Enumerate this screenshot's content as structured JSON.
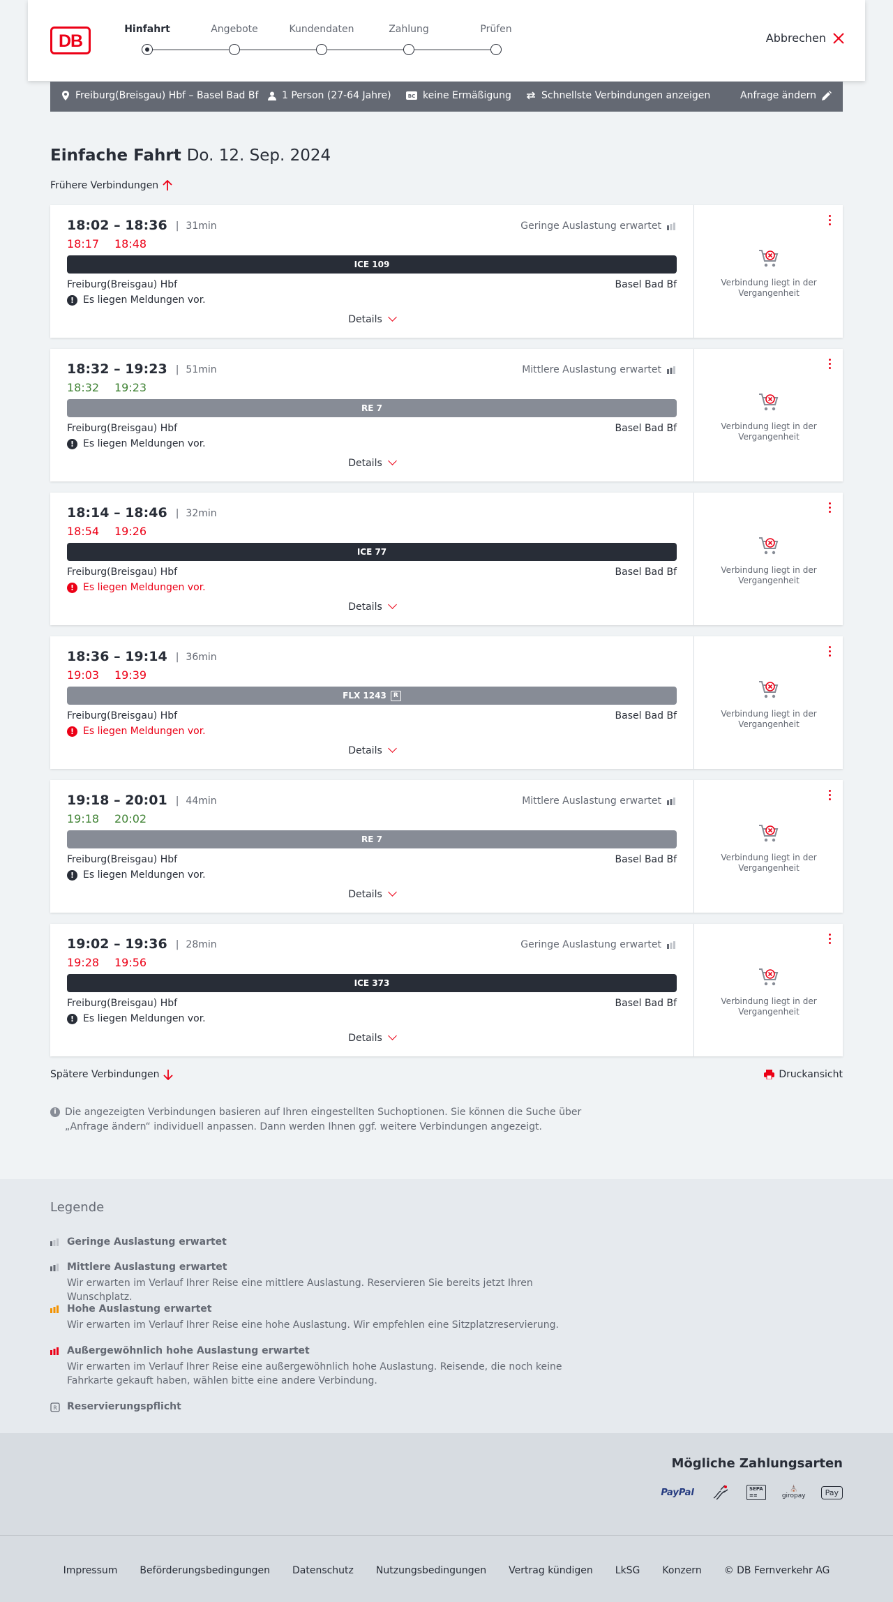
{
  "header": {
    "logo_text": "DB",
    "steps": [
      "Hinfahrt",
      "Angebote",
      "Kundendaten",
      "Zahlung",
      "Prüfen"
    ],
    "active_step": "Hinfahrt",
    "cancel_label": "Abbrechen"
  },
  "filter": {
    "route": "Freiburg(Breisgau) Hbf – Basel Bad Bf",
    "passengers": "1 Person (27-64 Jahre)",
    "discount": "keine Ermäßigung",
    "fastest": "Schnellste Verbindungen anzeigen",
    "change_label": "Anfrage ändern"
  },
  "page": {
    "title": "Einfache Fahrt",
    "date": "Do. 12. Sep. 2024",
    "earlier_label": "Frühere Verbindungen",
    "later_label": "Spätere Verbindungen",
    "print_label": "Druckansicht",
    "info_text": "Die angezeigten Verbindungen basieren auf Ihren eingestellten Suchoptionen. Sie können die Suche über „Anfrage ändern“ individuell anpassen. Dann werden Ihnen ggf. weitere Verbindungen angezeigt."
  },
  "connections": [
    {
      "times": "18:02 – 18:36",
      "duration": "31min",
      "rt_dep": "18:17",
      "rt_arr": "18:48",
      "rt_status": "red",
      "occupancy": "Geringe Auslastung erwartet",
      "train": "ICE 109",
      "train_style": "dark",
      "reservation": false,
      "from": "Freiburg(Breisgau) Hbf",
      "to": "Basel Bad Bf",
      "message": "Es liegen Meldungen vor.",
      "message_style": "normal",
      "details": "Details",
      "past_text": "Verbindung liegt in der Vergangenheit"
    },
    {
      "times": "18:32 – 19:23",
      "duration": "51min",
      "rt_dep": "18:32",
      "rt_arr": "19:23",
      "rt_status": "green",
      "occupancy": "Mittlere Auslastung erwartet",
      "train": "RE 7",
      "train_style": "grey",
      "reservation": false,
      "from": "Freiburg(Breisgau) Hbf",
      "to": "Basel Bad Bf",
      "message": "Es liegen Meldungen vor.",
      "message_style": "normal",
      "details": "Details",
      "past_text": "Verbindung liegt in der Vergangenheit"
    },
    {
      "times": "18:14 – 18:46",
      "duration": "32min",
      "rt_dep": "18:54",
      "rt_arr": "19:26",
      "rt_status": "red",
      "occupancy": "",
      "train": "ICE 77",
      "train_style": "dark",
      "reservation": false,
      "from": "Freiburg(Breisgau) Hbf",
      "to": "Basel Bad Bf",
      "message": "Es liegen Meldungen vor.",
      "message_style": "red",
      "details": "Details",
      "past_text": "Verbindung liegt in der Vergangenheit"
    },
    {
      "times": "18:36 – 19:14",
      "duration": "36min",
      "rt_dep": "19:03",
      "rt_arr": "19:39",
      "rt_status": "red",
      "occupancy": "",
      "train": "FLX 1243",
      "train_style": "grey",
      "reservation": true,
      "reservation_symbol": "R",
      "from": "Freiburg(Breisgau) Hbf",
      "to": "Basel Bad Bf",
      "message": "Es liegen Meldungen vor.",
      "message_style": "red",
      "details": "Details",
      "past_text": "Verbindung liegt in der Vergangenheit"
    },
    {
      "times": "19:18 – 20:01",
      "duration": "44min",
      "rt_dep": "19:18",
      "rt_arr": "20:02",
      "rt_status": "green",
      "occupancy": "Mittlere Auslastung erwartet",
      "train": "RE 7",
      "train_style": "grey",
      "reservation": false,
      "from": "Freiburg(Breisgau) Hbf",
      "to": "Basel Bad Bf",
      "message": "Es liegen Meldungen vor.",
      "message_style": "normal",
      "details": "Details",
      "past_text": "Verbindung liegt in der Vergangenheit"
    },
    {
      "times": "19:02 – 19:36",
      "duration": "28min",
      "rt_dep": "19:28",
      "rt_arr": "19:56",
      "rt_status": "red",
      "occupancy": "Geringe Auslastung erwartet",
      "train": "ICE 373",
      "train_style": "dark",
      "reservation": false,
      "from": "Freiburg(Breisgau) Hbf",
      "to": "Basel Bad Bf",
      "message": "Es liegen Meldungen vor.",
      "message_style": "normal",
      "details": "Details",
      "past_text": "Verbindung liegt in der Vergangenheit"
    }
  ],
  "legend": {
    "title": "Legende",
    "items": [
      {
        "title": "Geringe Auslastung erwartet",
        "text": "",
        "color": "#646973",
        "level": 1
      },
      {
        "title": "Mittlere Auslastung erwartet",
        "text": "Wir erwarten im Verlauf Ihrer Reise eine mittlere Auslastung. Reservieren Sie bereits jetzt Ihren Wunschplatz.",
        "color": "#646973",
        "level": 2
      },
      {
        "title": "Hohe Auslastung erwartet",
        "text": "Wir erwarten im Verlauf Ihrer Reise eine hohe Auslastung. Wir empfehlen eine Sitzplatzreservierung.",
        "color": "#f39200",
        "level": 3
      },
      {
        "title": "Außergewöhnlich hohe Auslastung erwartet",
        "text": "Wir erwarten im Verlauf Ihrer Reise eine außergewöhnlich hohe Auslastung. Reisende, die noch keine Fahrkarte gekauft haben, wählen bitte eine andere Verbindung.",
        "color": "#ec0016",
        "level": 4
      },
      {
        "title": "Reservierungspflicht",
        "text": "",
        "color": "#646973",
        "level": 0,
        "symbol": "R"
      }
    ]
  },
  "payment": {
    "title": "Mögliche Zahlungsarten",
    "logos": [
      {
        "name": "paypal-icon",
        "text": "PayPal"
      },
      {
        "name": "credit-card-icon",
        "text": ""
      },
      {
        "name": "sepa-icon",
        "text": "SEPA"
      },
      {
        "name": "giropay-icon",
        "text": "giropay"
      },
      {
        "name": "apple-pay-icon",
        "text": "Pay"
      }
    ]
  },
  "footer": {
    "links": [
      "Impressum",
      "Beförderungsbedingungen",
      "Datenschutz",
      "Nutzungsbedingungen",
      "Vertrag kündigen",
      "LkSG",
      "Konzern",
      "© DB Fernverkehr AG"
    ]
  },
  "colors": {
    "accent": "#ec0016",
    "ontime": "#408335",
    "dark": "#282d37",
    "muted": "#646973"
  }
}
